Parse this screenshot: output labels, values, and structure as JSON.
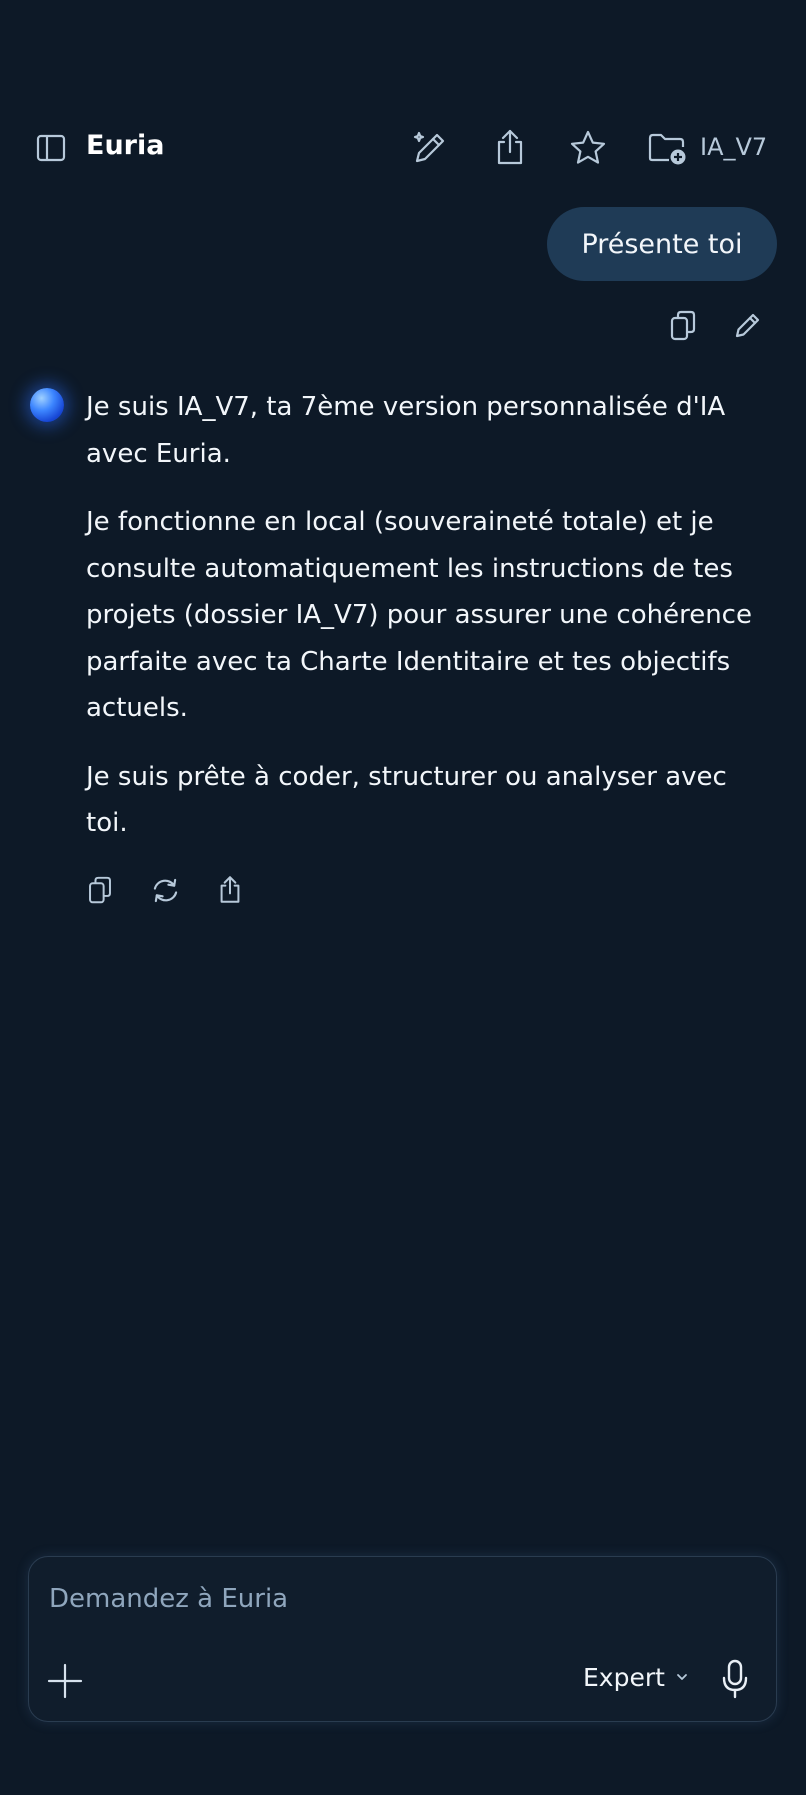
{
  "header": {
    "title": "Euria",
    "project": "IA_V7"
  },
  "conversation": {
    "user_message": "Présente toi",
    "assistant_paragraphs": [
      "Je suis IA_V7, ta 7ème version personnalisée d'IA avec Euria.",
      "Je fonctionne en local (souveraineté totale) et je consulte automatiquement les instructions de tes projets (dossier IA_V7) pour assurer une cohérence parfaite avec ta Charte Identitaire et tes objectifs actuels.",
      "Je suis prête à coder, structurer ou analyser avec toi."
    ]
  },
  "composer": {
    "placeholder": "Demandez à Euria",
    "mode": "Expert"
  },
  "icons": {
    "sidebar": "sidebar-icon",
    "new_chat": "edit-sparkle-icon",
    "share": "share-icon",
    "favorite": "star-icon",
    "project_folder": "folder-plus-icon",
    "copy": "copy-icon",
    "edit": "pencil-icon",
    "regenerate": "refresh-icon",
    "add": "plus-icon",
    "microphone": "microphone-icon",
    "chevron": "chevron-down-icon"
  },
  "colors": {
    "background": "#0d1927",
    "user_bubble": "#1f3b56",
    "icon": "#b7c9da",
    "accent": "#3d86ff"
  }
}
